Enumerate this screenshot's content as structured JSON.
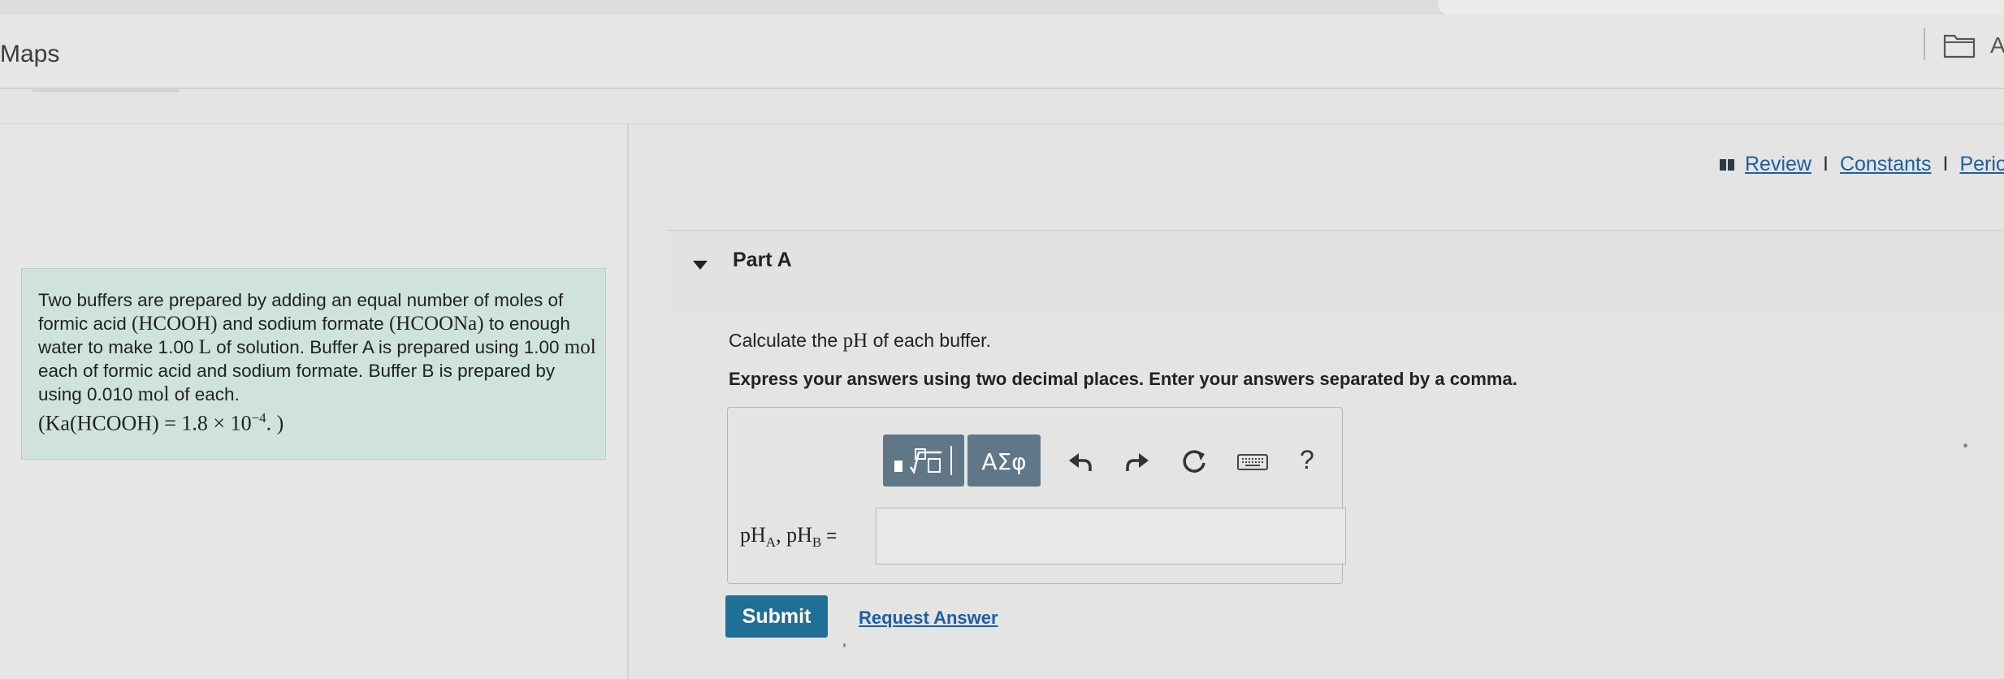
{
  "app": {
    "title": "Maps",
    "partial_header_letter": "A"
  },
  "top_links": {
    "review": "Review",
    "separator": "I",
    "constants": "Constants",
    "periodic": "Perio"
  },
  "problem": {
    "text_parts": [
      "Two buffers are prepared by adding an equal number of moles of formic acid ",
      "(HCOOH)",
      " and sodium formate ",
      "(HCOONa)",
      " to enough water to make 1.00 ",
      "L",
      " of solution. Buffer A is prepared using 1.00 ",
      "mol",
      " each of formic acid and sodium formate. Buffer B is prepared by using 0.010 ",
      "mol",
      " of each."
    ],
    "ka_expression": "(Ka(HCOOH) = 1.8 × 10",
    "ka_exponent": "−4",
    "ka_tail": ". )"
  },
  "part": {
    "title": "Part A"
  },
  "question": {
    "prefix": "Calculate the ",
    "symbol": "pH",
    "suffix": " of each buffer."
  },
  "instructions": "Express your answers using two decimal places. Enter your answers separated by a comma.",
  "toolbar": {
    "greek_label": "ΑΣφ",
    "help_label": "?",
    "icons": [
      "templates-icon",
      "greek-symbols-icon",
      "undo-icon",
      "redo-icon",
      "reset-icon",
      "keyboard-icon",
      "help-icon"
    ]
  },
  "answer": {
    "label_ph": "pH",
    "sub_a": "A",
    "comma": ", ",
    "sub_b": "B",
    "equals": " =",
    "value": ""
  },
  "buttons": {
    "submit": "Submit",
    "request_answer": "Request Answer"
  },
  "colors": {
    "problem_bg": "#cfe3db",
    "tool_button": "#5f7786",
    "submit_bg": "#1f6f96",
    "link": "#1c5fa1"
  }
}
